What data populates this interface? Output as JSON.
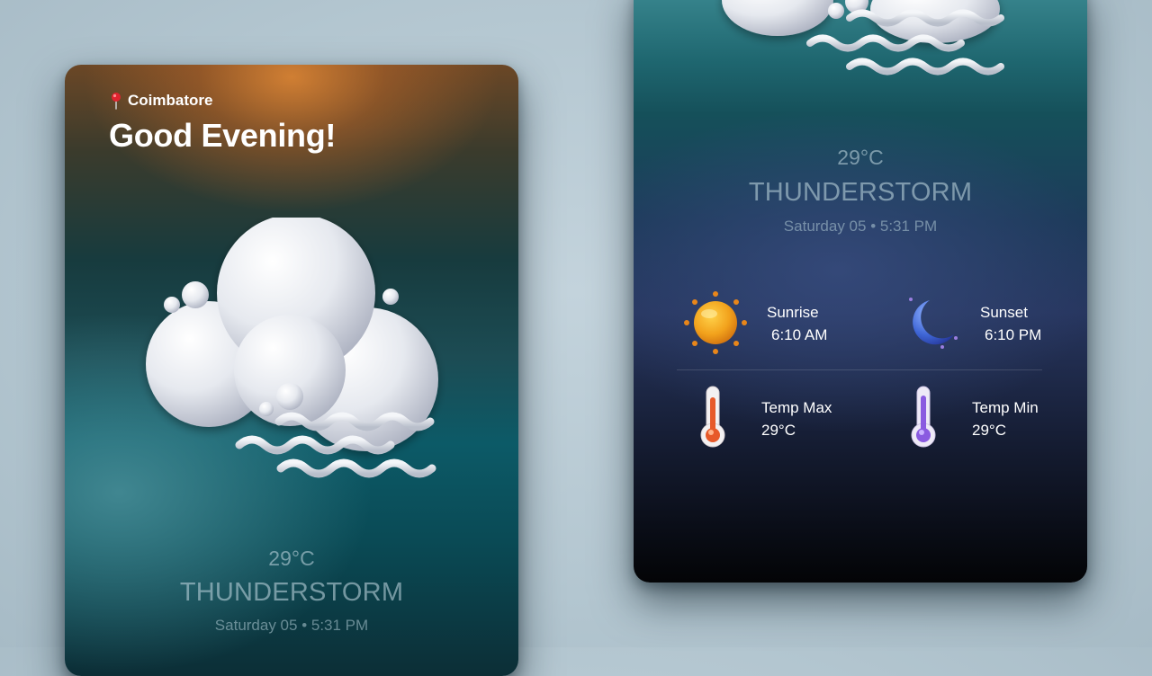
{
  "location": "Coimbatore",
  "greeting": "Good Evening!",
  "weather": {
    "temperature": "29°C",
    "condition": "THUNDERSTORM",
    "datetime": "Saturday 05 • 5:31 PM"
  },
  "details": {
    "sunrise": {
      "label": "Sunrise",
      "value": "6:10 AM",
      "icon": "sun-icon"
    },
    "sunset": {
      "label": "Sunset",
      "value": "6:10 PM",
      "icon": "moon-icon"
    },
    "temp_max": {
      "label": "Temp Max",
      "value": "29°C",
      "icon": "thermometer-hot-icon"
    },
    "temp_min": {
      "label": "Temp Min",
      "value": "29°C",
      "icon": "thermometer-cold-icon"
    }
  },
  "colors": {
    "accent_orange": "#d6823a",
    "teal": "#0c5a67",
    "navy": "#27365f",
    "background": "#b9cbd5"
  }
}
